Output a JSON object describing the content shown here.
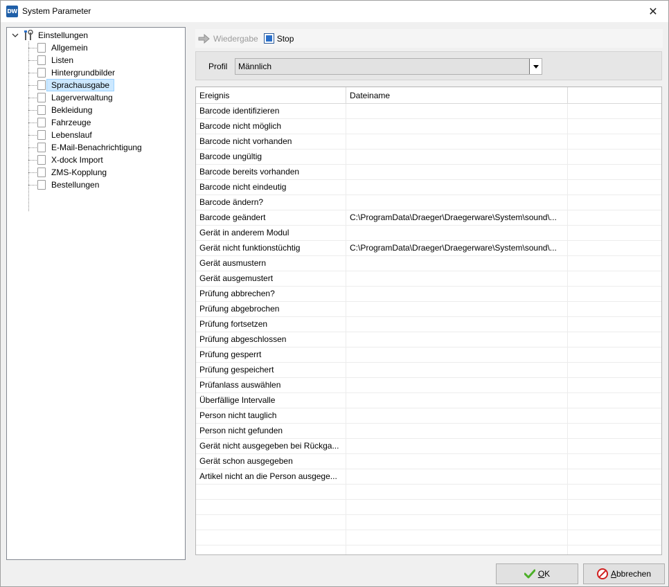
{
  "window": {
    "title": "System Parameter",
    "app_icon_text": "DW",
    "close_glyph": "✕"
  },
  "tree": {
    "root_label": "Einstellungen",
    "items": [
      {
        "label": "Allgemein"
      },
      {
        "label": "Listen"
      },
      {
        "label": "Hintergrundbilder"
      },
      {
        "label": "Sprachausgabe",
        "selected": true
      },
      {
        "label": "Lagerverwaltung"
      },
      {
        "label": "Bekleidung"
      },
      {
        "label": "Fahrzeuge"
      },
      {
        "label": "Lebenslauf"
      },
      {
        "label": "E-Mail-Benachrichtigung"
      },
      {
        "label": "X-dock Import"
      },
      {
        "label": "ZMS-Kopplung"
      },
      {
        "label": "Bestellungen"
      }
    ]
  },
  "toolbar": {
    "play_label": "Wiedergabe",
    "play_icon": "arrow-right-icon",
    "stop_label": "Stop",
    "stop_icon": "stop-icon"
  },
  "profile": {
    "label": "Profil",
    "selected_value": "Männlich"
  },
  "grid": {
    "columns": [
      "Ereignis",
      "Dateiname",
      ""
    ],
    "rows": [
      [
        "Barcode identifizieren",
        ""
      ],
      [
        "Barcode nicht möglich",
        ""
      ],
      [
        "Barcode nicht vorhanden",
        ""
      ],
      [
        "Barcode ungültig",
        ""
      ],
      [
        "Barcode bereits vorhanden",
        ""
      ],
      [
        "Barcode nicht eindeutig",
        ""
      ],
      [
        "Barcode ändern?",
        ""
      ],
      [
        "Barcode geändert",
        "C:\\ProgramData\\Draeger\\Draegerware\\System\\sound\\..."
      ],
      [
        "Gerät in anderem Modul",
        ""
      ],
      [
        "Gerät nicht funktionstüchtig",
        "C:\\ProgramData\\Draeger\\Draegerware\\System\\sound\\..."
      ],
      [
        "Gerät ausmustern",
        ""
      ],
      [
        "Gerät ausgemustert",
        ""
      ],
      [
        "Prüfung abbrechen?",
        ""
      ],
      [
        "Prüfung abgebrochen",
        ""
      ],
      [
        "Prüfung fortsetzen",
        ""
      ],
      [
        "Prüfung abgeschlossen",
        ""
      ],
      [
        "Prüfung gesperrt",
        ""
      ],
      [
        "Prüfung gespeichert",
        ""
      ],
      [
        "Prüfanlass auswählen",
        ""
      ],
      [
        "Überfällige Intervalle",
        ""
      ],
      [
        "Person nicht tauglich",
        ""
      ],
      [
        "Person nicht gefunden",
        ""
      ],
      [
        "Gerät nicht ausgegeben bei Rückga...",
        ""
      ],
      [
        "Gerät schon ausgegeben",
        ""
      ],
      [
        "Artikel nicht an die Person ausgege...",
        ""
      ],
      [
        "",
        ""
      ],
      [
        "",
        ""
      ],
      [
        "",
        ""
      ],
      [
        "",
        ""
      ],
      [
        "",
        ""
      ]
    ]
  },
  "buttons": {
    "ok_mnemonic": "O",
    "ok_rest": "K",
    "cancel_mnemonic": "A",
    "cancel_rest": "bbrechen"
  },
  "colors": {
    "selection_bg": "#cce8ff",
    "selection_border": "#99d1ff",
    "app_icon_bg": "#1f5fa8",
    "ok_check": "#4caf28",
    "cancel_red": "#d02020"
  }
}
